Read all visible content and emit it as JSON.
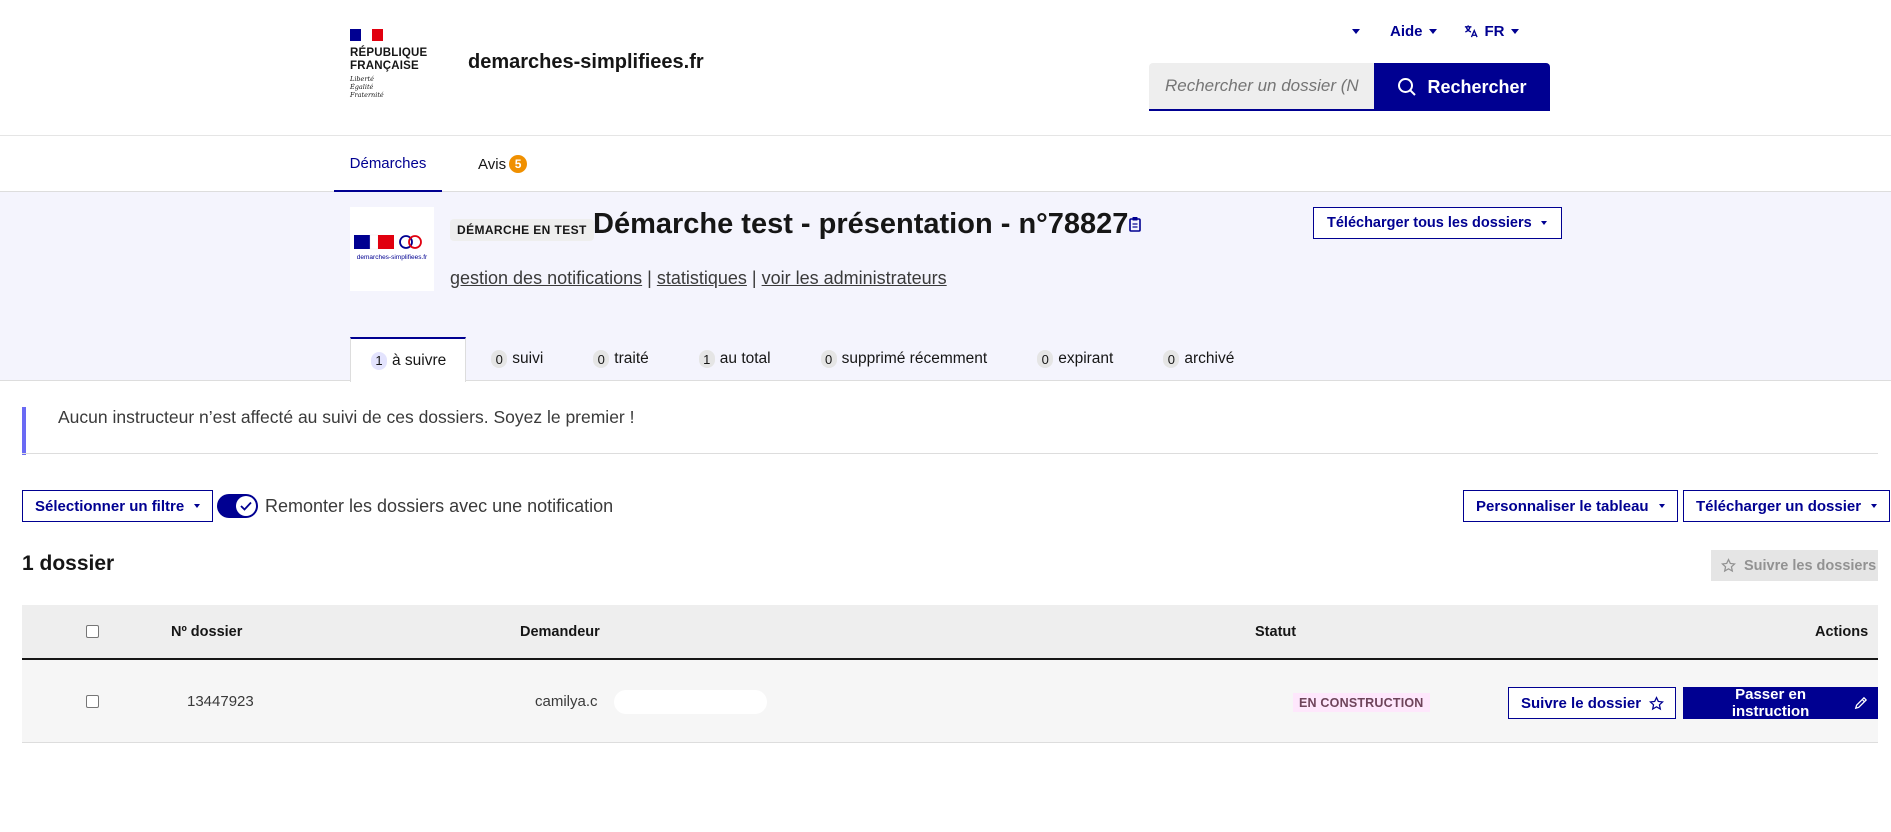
{
  "header": {
    "rf_lines": [
      "RÉPUBLIQUE",
      "FRANÇAISE"
    ],
    "devise": [
      "Liberté",
      "Égalité",
      "Fraternité"
    ],
    "site_name": "demarches-simplifiees.fr",
    "aide_label": "Aide",
    "lang_label": "FR",
    "search_placeholder": "Rechercher un dossier (N°",
    "search_button": "Rechercher"
  },
  "nav": {
    "demarches": "Démarches",
    "avis": "Avis",
    "avis_count": "5"
  },
  "procedure": {
    "logo_caption": "demarches-simplifiees.fr",
    "tag": "DÉMARCHE EN TEST",
    "title": "Démarche test - présentation - n°78827",
    "links": [
      "gestion des notifications",
      "statistiques",
      "voir les administrateurs"
    ],
    "separator": "|",
    "download_all": "Télécharger tous les dossiers"
  },
  "tabs": [
    {
      "count": "1",
      "label": "à suivre"
    },
    {
      "count": "0",
      "label": "suivi"
    },
    {
      "count": "0",
      "label": "traité"
    },
    {
      "count": "1",
      "label": "au total"
    },
    {
      "count": "0",
      "label": "supprimé récemment"
    },
    {
      "count": "0",
      "label": "expirant"
    },
    {
      "count": "0",
      "label": "archivé"
    }
  ],
  "callout": "Aucun instructeur n’est affecté au suivi de ces dossiers. Soyez le premier !",
  "toolbar": {
    "filter_button": "Sélectionner un filtre",
    "toggle_label": "Remonter les dossiers avec une notification",
    "customize_button": "Personnaliser le tableau",
    "download_one_button": "Télécharger un dossier"
  },
  "list": {
    "count_title": "1 dossier",
    "follow_all": "Suivre les dossiers",
    "columns": {
      "numero": "Nº dossier",
      "demandeur": "Demandeur",
      "statut": "Statut",
      "actions": "Actions"
    },
    "rows": [
      {
        "numero": "13447923",
        "demandeur": "camilya.c",
        "statut": "EN CONSTRUCTION",
        "follow": "Suivre le dossier",
        "instruct": "Passer en instruction"
      }
    ]
  },
  "colors": {
    "primary": "#000091",
    "band": "#f4f4fd",
    "accent_orange": "#f09000",
    "callout_border": "#6a6af4",
    "flag_blue": "#000091",
    "flag_red": "#e1000f"
  }
}
